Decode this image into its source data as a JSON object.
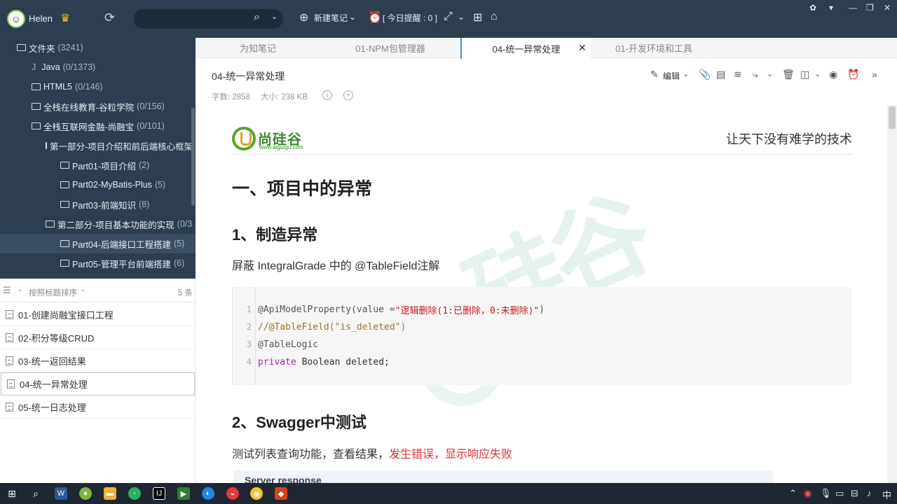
{
  "user": {
    "name": "Helen"
  },
  "toolbar": {
    "new_note": "新建笔记",
    "reminder": "[ 今日提醒 : 0 ]"
  },
  "sidebar": {
    "items": [
      {
        "label": "文件夹",
        "count": "(3241)"
      },
      {
        "label": "Java",
        "count": "(0/1373)"
      },
      {
        "label": "HTML5",
        "count": "(0/146)"
      },
      {
        "label": "全栈在线教育-谷粒学院",
        "count": "(0/156)"
      },
      {
        "label": "全栈互联网金融-尚融宝",
        "count": "(0/101)"
      },
      {
        "label": "第一部分-项目介绍和前后端核心框架",
        "count": ""
      },
      {
        "label": "Part01-项目介绍",
        "count": "(2)"
      },
      {
        "label": "Part02-MyBatis-Plus",
        "count": "(5)"
      },
      {
        "label": "Part03-前端知识",
        "count": "(8)"
      },
      {
        "label": "第二部分-项目基本功能的实现",
        "count": "(0/3"
      },
      {
        "label": "Part04-后端接口工程搭建",
        "count": "(5)"
      },
      {
        "label": "Part05-管理平台前端搭建",
        "count": "(6)"
      }
    ]
  },
  "notelist": {
    "sort_label": "按照标题排序",
    "count": "5 条",
    "notes": [
      "01-创建尚融宝接口工程",
      "02-积分等级CRUD",
      "03-统一返回结果",
      "04-统一异常处理",
      "05-统一日志处理"
    ]
  },
  "tabs": [
    "为知笔记",
    "01-NPM包管理器",
    "04-统一异常处理",
    "01-开发环境和工具"
  ],
  "note": {
    "title": "04-统一异常处理",
    "word_label": "字数: 2858",
    "size_label": "大小: 238 KB",
    "edit_label": "编辑"
  },
  "doc": {
    "logo_text": "尚硅谷",
    "logo_url": "www.atguigu.com",
    "slogan": "让天下没有难学的技术",
    "h1": "一、项目中的异常",
    "h2_1": "1、制造异常",
    "p1": "屏蔽 IntegralGrade 中的 @TableField注解",
    "code": {
      "line_numbers": [
        "1",
        "2",
        "3",
        "4"
      ],
      "l1_anno": "@ApiModelProperty(value = ",
      "l1_str": "\"逻辑删除(1:已删除，0:未删除)\"",
      "l1_end": ")",
      "l2": "//@TableField(\"is_deleted\")",
      "l3": "@TableLogic",
      "l4_kw": "private",
      "l4_rest": " Boolean deleted;"
    },
    "h2_2": "2、Swagger中测试",
    "p2_normal": "测试列表查询功能，查看结果，",
    "p2_red": "发生错误，显示响应失败",
    "server_response": "Server response"
  },
  "taskbar": {
    "ime": "中"
  },
  "colors": {
    "sidebar_bg": "#2c3e50",
    "accent_red": "#e03131",
    "brand_green": "#3a8c2e"
  }
}
